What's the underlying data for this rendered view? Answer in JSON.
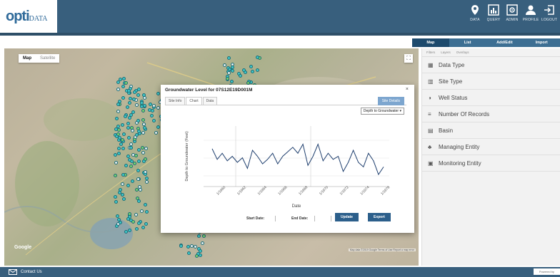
{
  "header": {
    "logo_main": "opti",
    "logo_sub": "DATA",
    "nav": [
      {
        "label": "DATA",
        "icon": "map-pin-icon"
      },
      {
        "label": "QUERY",
        "icon": "bar-chart-icon"
      },
      {
        "label": "ADMIN",
        "icon": "admin-icon"
      },
      {
        "label": "PROFILE",
        "icon": "user-icon"
      },
      {
        "label": "LOGOUT",
        "icon": "logout-icon"
      }
    ]
  },
  "tabs": [
    "Map",
    "List",
    "Add/Edit",
    "Import"
  ],
  "map": {
    "toggle_map": "Map",
    "toggle_satellite": "Satellite",
    "google": "Google",
    "attribution": "Map data ©2019 Google  Terms of Use  Report a map error",
    "point_color": "#40c8c8",
    "point_color_selected": "#7ad36a"
  },
  "panel": {
    "tabs": [
      "Filters",
      "Layers",
      "Overlays"
    ],
    "filters": [
      {
        "label": "Data Type",
        "icon": "database-icon"
      },
      {
        "label": "Site Type",
        "icon": "building-icon"
      },
      {
        "label": "Well Status",
        "icon": "drop-icon"
      },
      {
        "label": "Number Of Records",
        "icon": "list-icon"
      },
      {
        "label": "Basin",
        "icon": "basin-icon"
      },
      {
        "label": "Managing Entity",
        "icon": "group-icon"
      },
      {
        "label": "Monitoring Entity",
        "icon": "monitor-icon"
      }
    ]
  },
  "modal": {
    "title": "Groundwater Level for 07S12E19D001M",
    "close": "×",
    "tabs": [
      "Site Info",
      "Chart",
      "Data"
    ],
    "site_details": "Site Details",
    "depth_select": "Depth to Groundwater ▾",
    "start_date_label": "Start Date:",
    "end_date_label": "End Date:",
    "update": "Update",
    "export": "Export"
  },
  "chart_data": {
    "type": "line",
    "ylabel": "Depth to Groundwater (Feet)",
    "xlabel": "Date",
    "x": [
      "1/1960",
      "1/1962",
      "1/1964",
      "1/1966",
      "1/1968",
      "1/1970",
      "1/1972",
      "1/1974",
      "1/1976"
    ],
    "values": [
      55,
      48,
      52,
      47,
      50,
      46,
      49,
      42,
      54,
      50,
      45,
      48,
      52,
      45,
      50,
      53,
      56,
      52,
      58,
      44,
      50,
      58,
      47,
      52,
      48,
      50,
      40,
      46,
      54,
      46,
      43,
      52,
      47,
      38,
      43
    ],
    "line_color": "#1f3f6e"
  },
  "footer": {
    "contact": "Contact Us",
    "powered": "Powered by"
  }
}
